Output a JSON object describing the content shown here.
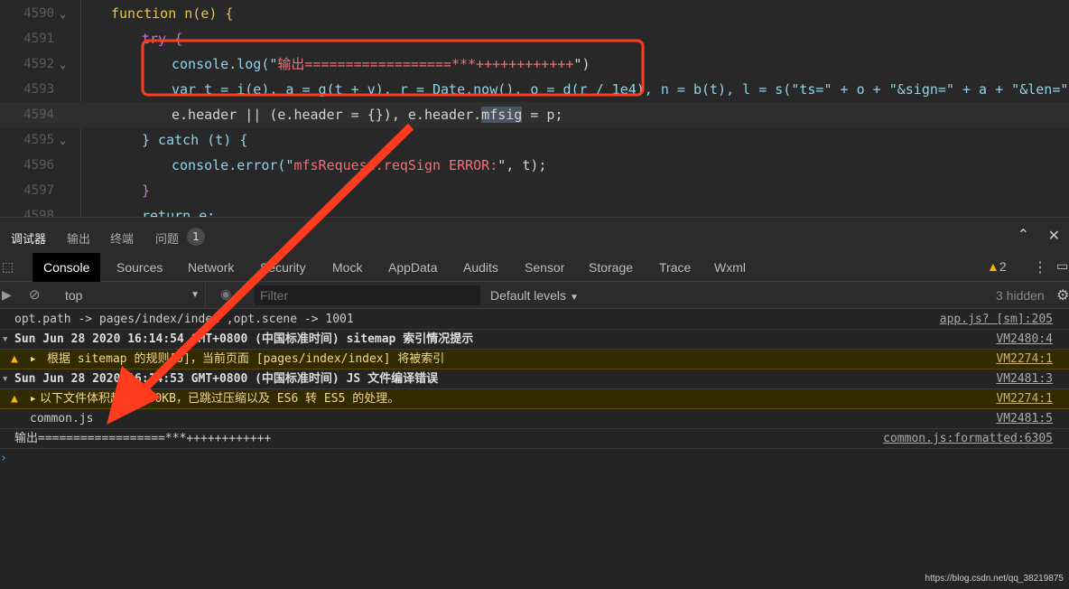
{
  "editor": {
    "lines": [
      {
        "n": "4590",
        "fold": true
      },
      {
        "n": "4591"
      },
      {
        "n": "4592",
        "fold": true
      },
      {
        "n": "4593"
      },
      {
        "n": "4594"
      },
      {
        "n": "4595",
        "fold": true
      },
      {
        "n": "4596"
      },
      {
        "n": "4597"
      },
      {
        "n": "4598"
      }
    ],
    "code": {
      "l4590": "function n(e) {",
      "l4591": "try {",
      "l4592a": "console.log(\"",
      "l4592b": "输出==================***++++++++++++",
      "l4592c": "\")",
      "l4593": "var t = i(e), a = g(t + v), r = Date.now(), o = d(r / 1e4), n = b(t), l = s(\"ts=\" + o + \"&sign=\" + a + \"&len=\" + n + \"",
      "l4594a": "e.header || (e.header = {}), e.header.",
      "l4594b": "mfsig",
      "l4594c": " = p;",
      "l4595": "} catch (t) {",
      "l4596a": "console.error(\"",
      "l4596b": "mfsRequest.reqSign ERROR:",
      "l4596c": "\", t);",
      "l4597": "}",
      "l4598": "return e;"
    }
  },
  "panel_tabs": [
    {
      "label": "调试器"
    },
    {
      "label": "输出"
    },
    {
      "label": "终端"
    },
    {
      "label": "问题"
    }
  ],
  "problems_count": "1",
  "devtools_tabs": [
    "Console",
    "Sources",
    "Network",
    "Security",
    "Mock",
    "AppData",
    "Audits",
    "Sensor",
    "Storage",
    "Trace",
    "Wxml"
  ],
  "warning_count": "2",
  "toolbar": {
    "context": "top",
    "filter_placeholder": "Filter",
    "levels": "Default levels",
    "hidden": "3 hidden"
  },
  "messages": [
    {
      "text": "opt.path -> pages/index/index ,opt.scene -> 1001",
      "src": "app.js? [sm]:205"
    },
    {
      "text": "Sun Jun 28 2020 16:14:54 GMT+0800 (中国标准时间) sitemap 索引情况提示",
      "src": "VM2480:4"
    },
    {
      "text": "根据 sitemap 的规则[0]，当前页面 [pages/index/index] 将被索引",
      "src": "VM2274:1"
    },
    {
      "text": "Sun Jun 28 2020 16:14:53 GMT+0800 (中国标准时间) JS 文件编译错误",
      "src": "VM2481:3"
    },
    {
      "text": "以下文件体积超过 500KB，已跳过压缩以及 ES6 转 ES5 的处理。",
      "src": "VM2274:1"
    },
    {
      "text": "common.js",
      "src": "VM2481:5"
    },
    {
      "text": "输出==================***++++++++++++",
      "src": "common.js:formatted:6305"
    }
  ],
  "watermark": "https://blog.csdn.net/qq_38219875",
  "colors": {
    "annotation": "#ff3b1f",
    "warning": "#f5b800"
  }
}
